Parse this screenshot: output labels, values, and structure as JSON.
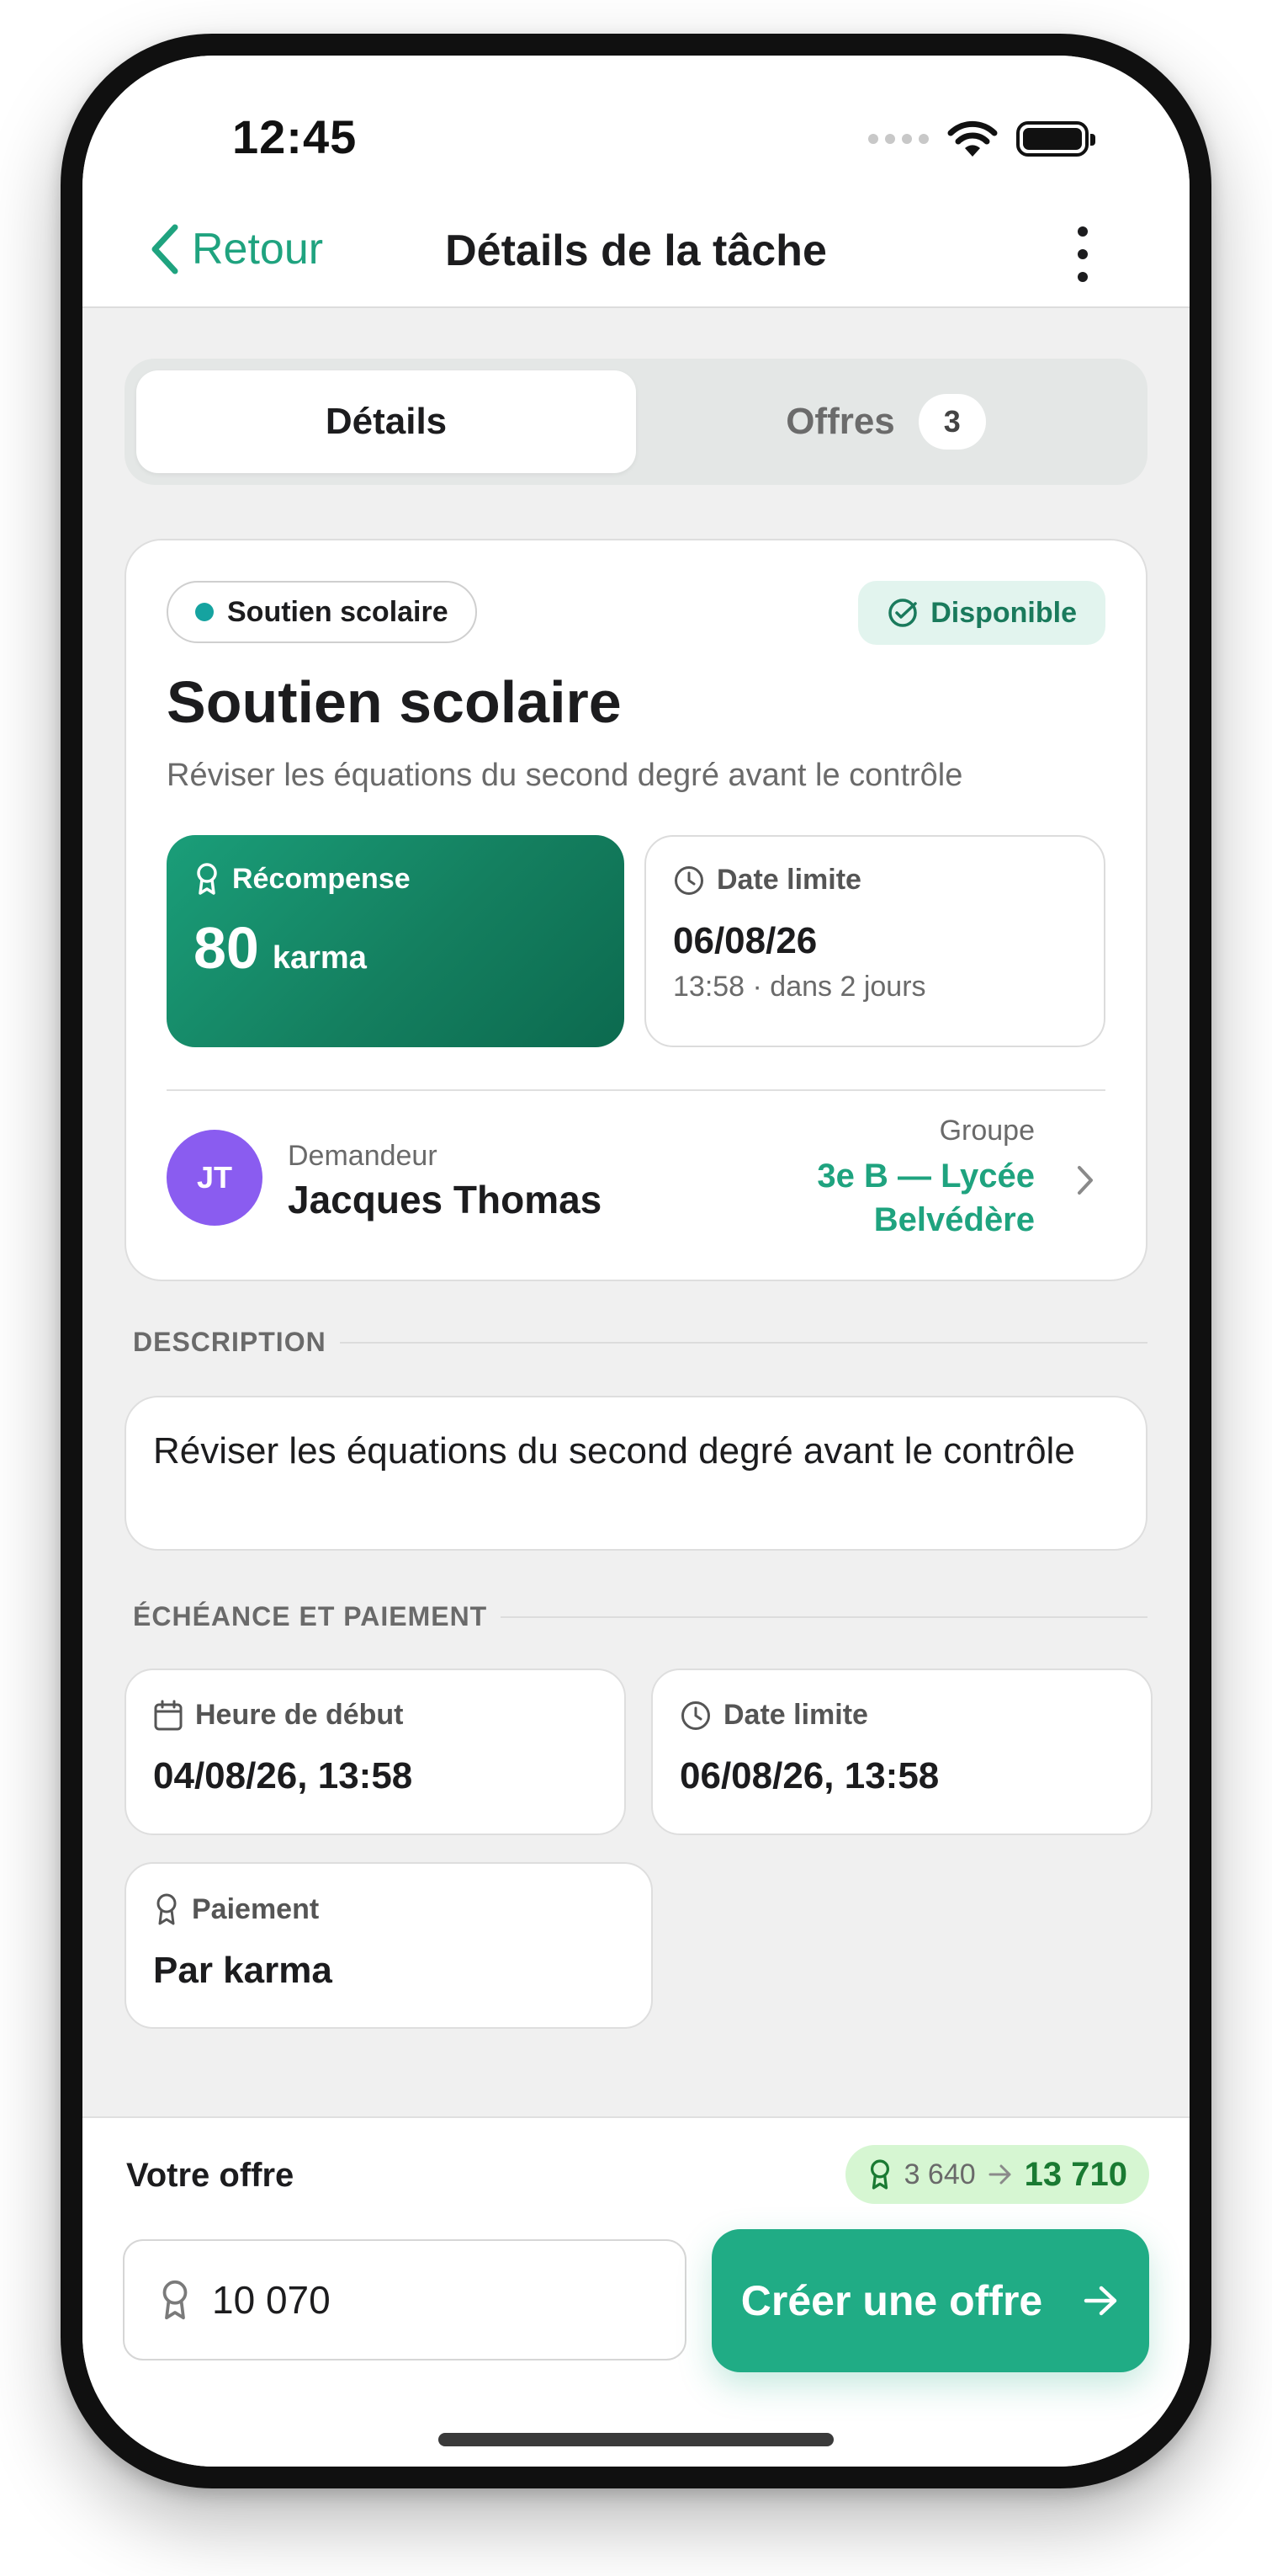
{
  "status_bar": {
    "time": "12:45"
  },
  "nav": {
    "back_label": "Retour",
    "title": "Détails de la tâche"
  },
  "tabs": [
    {
      "label": "Détails",
      "active": true
    },
    {
      "label": "Offres",
      "badge": "3",
      "active": false
    }
  ],
  "task": {
    "category": "Soutien scolaire",
    "status": "Disponible",
    "title": "Soutien scolaire",
    "subtitle": "Réviser les équations du second degré avant le contrôle",
    "reward": {
      "label": "Récompense",
      "value": "80",
      "unit": "karma"
    },
    "deadline": {
      "label": "Date limite",
      "date": "06/08/26",
      "relative": "13:58 · dans 2 jours"
    },
    "requester": {
      "initials": "JT",
      "label": "Demandeur",
      "name": "Jacques Thomas"
    },
    "group": {
      "label": "Groupe",
      "name": "3e B — Lycée Belvédère"
    }
  },
  "description_section": {
    "heading": "DESCRIPTION",
    "text": "Réviser les équations du second degré avant le contrôle"
  },
  "schedule_section": {
    "heading": "ÉCHÉANCE ET PAIEMENT",
    "start": {
      "label": "Heure de début",
      "value": "04/08/26, 13:58"
    },
    "deadline": {
      "label": "Date limite",
      "value": "06/08/26, 13:58"
    },
    "payment": {
      "label": "Paiement",
      "value": "Par karma"
    }
  },
  "offer": {
    "label": "Votre offre",
    "balance_from": "3 640",
    "balance_to": "13 710",
    "amount": "10 070",
    "submit_label": "Créer une offre"
  },
  "colors": {
    "accent": "#1fa37f",
    "avatar": "#8a5cf0",
    "category_dot": "#15a3a0"
  }
}
